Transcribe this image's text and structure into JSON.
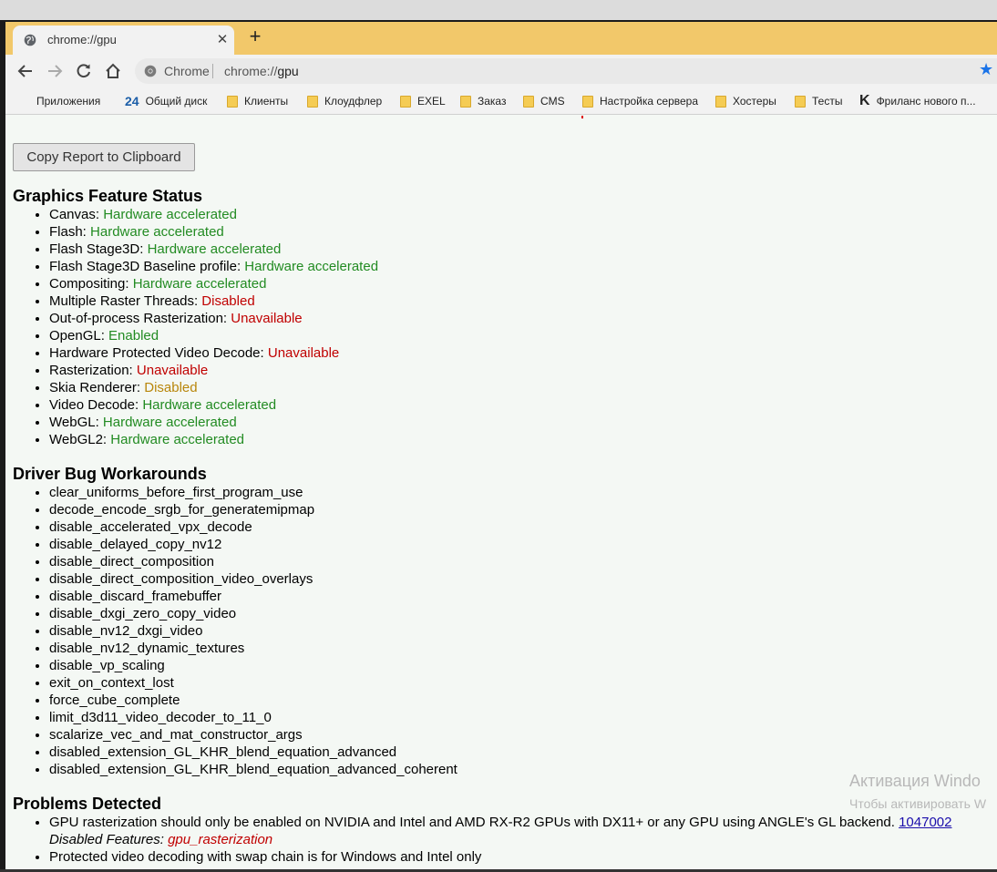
{
  "tab": {
    "title": "chrome://gpu"
  },
  "omnibox": {
    "site_label": "Chrome",
    "url_scheme": "chrome://",
    "url_host": "gpu"
  },
  "bookmarks": [
    {
      "label": "Приложения",
      "icon": "apps-grid-icon"
    },
    {
      "label": "Общий диск",
      "icon": "bitrix24-icon",
      "icon_text": "24"
    },
    {
      "label": "Клиенты",
      "icon": "folder-icon"
    },
    {
      "label": "Клоудфлер",
      "icon": "folder-icon"
    },
    {
      "label": "EXEL",
      "icon": "folder-icon"
    },
    {
      "label": "Заказ",
      "icon": "folder-icon"
    },
    {
      "label": "CMS",
      "icon": "folder-icon"
    },
    {
      "label": "Настройка сервера",
      "icon": "folder-icon"
    },
    {
      "label": "Хостеры",
      "icon": "folder-icon"
    },
    {
      "label": "Тесты",
      "icon": "folder-icon"
    },
    {
      "label": "Фриланс нового п...",
      "icon": "kwork-icon",
      "icon_text": "K"
    }
  ],
  "content": {
    "copy_button": "Copy Report to Clipboard",
    "feature_status": {
      "heading": "Graphics Feature Status",
      "items": [
        {
          "name": "Canvas:",
          "status": "Hardware accelerated"
        },
        {
          "name": "Flash:",
          "status": "Hardware accelerated"
        },
        {
          "name": "Flash Stage3D:",
          "status": "Hardware accelerated"
        },
        {
          "name": "Flash Stage3D Baseline profile:",
          "status": "Hardware accelerated"
        },
        {
          "name": "Compositing:",
          "status": "Hardware accelerated"
        },
        {
          "name": "Multiple Raster Threads:",
          "status": "Disabled"
        },
        {
          "name": "Out-of-process Rasterization:",
          "status": "Unavailable"
        },
        {
          "name": "OpenGL:",
          "status": "Enabled"
        },
        {
          "name": "Hardware Protected Video Decode:",
          "status": "Unavailable"
        },
        {
          "name": "Rasterization:",
          "status": "Unavailable"
        },
        {
          "name": "Skia Renderer:",
          "status": "Disabled"
        },
        {
          "name": "Video Decode:",
          "status": "Hardware accelerated"
        },
        {
          "name": "WebGL:",
          "status": "Hardware accelerated"
        },
        {
          "name": "WebGL2:",
          "status": "Hardware accelerated"
        }
      ]
    },
    "workarounds": {
      "heading": "Driver Bug Workarounds",
      "items": [
        "clear_uniforms_before_first_program_use",
        "decode_encode_srgb_for_generatemipmap",
        "disable_accelerated_vpx_decode",
        "disable_delayed_copy_nv12",
        "disable_direct_composition",
        "disable_direct_composition_video_overlays",
        "disable_discard_framebuffer",
        "disable_dxgi_zero_copy_video",
        "disable_nv12_dxgi_video",
        "disable_nv12_dynamic_textures",
        "disable_vp_scaling",
        "exit_on_context_lost",
        "force_cube_complete",
        "limit_d3d11_video_decoder_to_11_0",
        "scalarize_vec_and_mat_constructor_args",
        "disabled_extension_GL_KHR_blend_equation_advanced",
        "disabled_extension_GL_KHR_blend_equation_advanced_coherent"
      ]
    },
    "problems": {
      "heading": "Problems Detected",
      "problem1_text": "GPU rasterization should only be enabled on NVIDIA and Intel and AMD RX-R2 GPUs with DX11+ or any GPU using ANGLE's GL backend.",
      "problem1_link": "1047002",
      "problem1_disabled_label": "Disabled Features:",
      "problem1_disabled_value": "gpu_rasterization",
      "problem2_text": "Protected video decoding with swap chain is for Windows and Intel only"
    }
  },
  "watermark": {
    "line1": "Активация Windo",
    "line2": "Чтобы активировать W"
  },
  "colors": {
    "tab_strip": "#f2c86a",
    "status_green": "#228b22",
    "status_red": "#c00000",
    "status_yellow": "#b8860b",
    "star": "#1a73e8"
  }
}
